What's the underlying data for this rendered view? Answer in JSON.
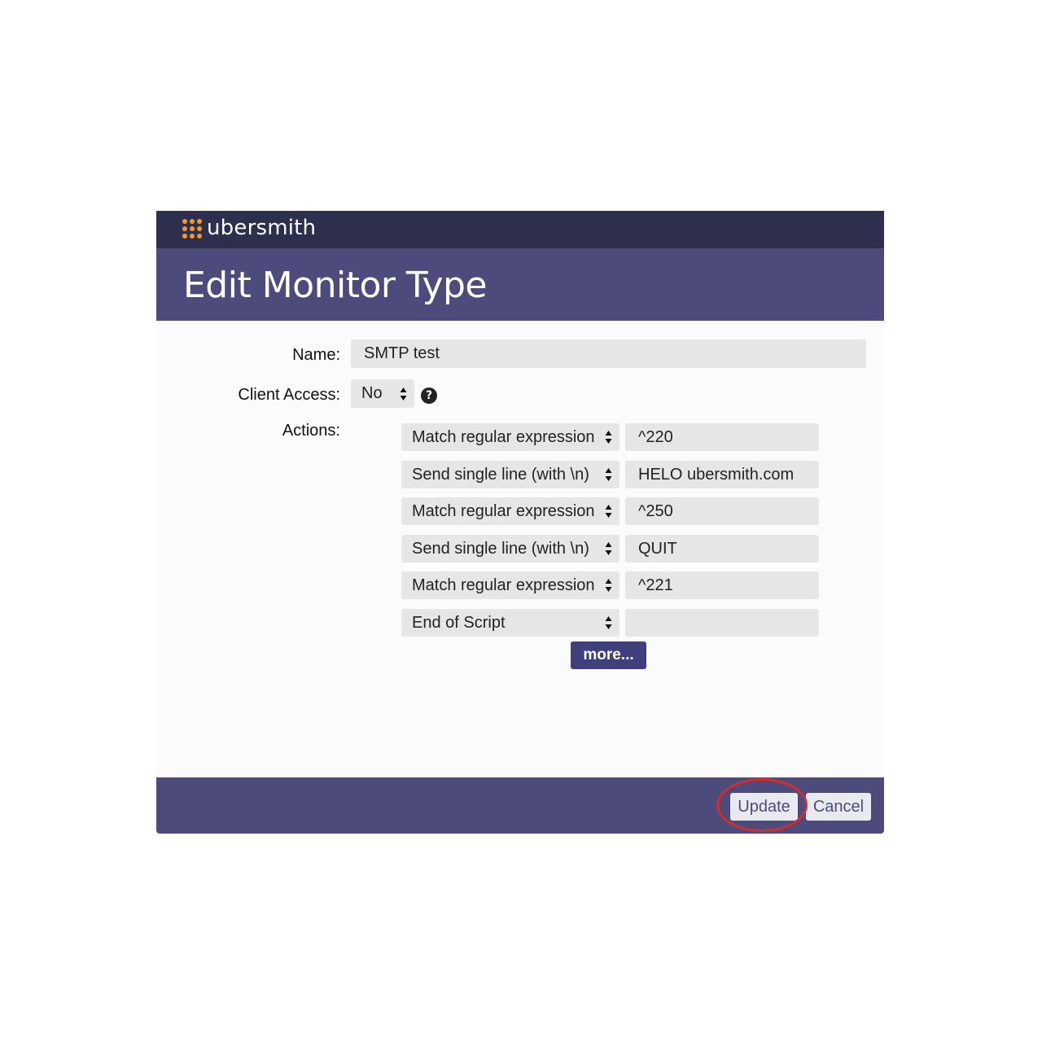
{
  "app": {
    "brand": "ubersmith",
    "brand_color": "#f29a21"
  },
  "page": {
    "title": "Edit Monitor Type"
  },
  "form": {
    "name_label": "Name:",
    "name_value": "SMTP test",
    "client_access_label": "Client Access:",
    "client_access_value": "No",
    "help_icon": "question-circle-icon",
    "help_glyph": "?",
    "actions_label": "Actions:",
    "actions": [
      {
        "type": "Match regular expression",
        "value": "^220"
      },
      {
        "type": "Send single line (with \\n)",
        "value": "HELO ubersmith.com"
      },
      {
        "type": "Match regular expression",
        "value": "^250"
      },
      {
        "type": "Send single line (with \\n)",
        "value": "QUIT"
      },
      {
        "type": "Match regular expression",
        "value": "^221"
      },
      {
        "type": "End of Script",
        "value": ""
      }
    ],
    "more_label": "more..."
  },
  "footer": {
    "update_label": "Update",
    "cancel_label": "Cancel",
    "highlight_color": "#d62b2b"
  },
  "colors": {
    "topbar": "#2e2e4d",
    "header": "#4c4b7c",
    "button_primary": "#403f7e"
  }
}
